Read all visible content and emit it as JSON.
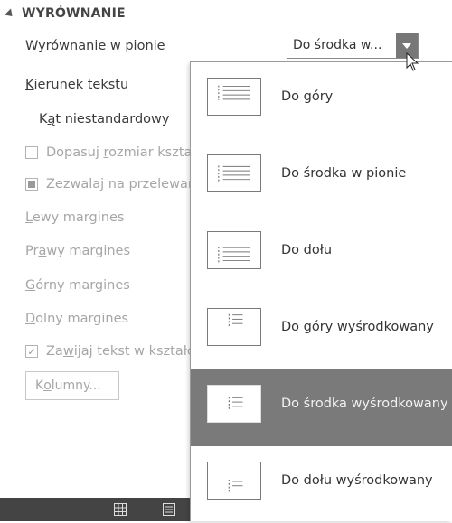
{
  "section": {
    "title": "WYRÓWNANIE"
  },
  "vertical_align": {
    "label_pre": "Wyrównan",
    "label_underlined": "i",
    "label_post": "e w pionie",
    "value": "Do środka w..."
  },
  "text_direction": {
    "label_underlined": "K",
    "label_post": "ierunek tekstu"
  },
  "custom_angle": {
    "label_pre": "K",
    "label_underlined": "ą",
    "label_post": "t niestandardowy"
  },
  "fit_shape": {
    "label_pre": "Dopasuj ",
    "label_underlined": "r",
    "label_post": "ozmiar kszta"
  },
  "allow_overflow": {
    "label": "Zezwalaj na przelewan"
  },
  "left_margin": {
    "label_underlined": "L",
    "label_post": "ewy margines"
  },
  "right_margin": {
    "label_pre": "Pr",
    "label_underlined": "a",
    "label_post": "wy margines"
  },
  "top_margin": {
    "label_underlined": "G",
    "label_post": "órny margines"
  },
  "bottom_margin": {
    "label_underlined": "D",
    "label_post": "olny margines"
  },
  "wrap_text": {
    "label_pre": "Za",
    "label_underlined": "w",
    "label_post": "ijaj tekst w kształc"
  },
  "columns": {
    "label_pre": "K",
    "label_underlined": "o",
    "label_post": "lumny..."
  },
  "dropdown": {
    "options": [
      {
        "label": "Do góry",
        "icon": "align-top-icon",
        "selected": false
      },
      {
        "label": "Do środka w pionie",
        "icon": "align-middle-icon",
        "selected": false
      },
      {
        "label": "Do dołu",
        "icon": "align-bottom-icon",
        "selected": false
      },
      {
        "label": "Do góry wyśrodkowany",
        "icon": "align-top-centered-icon",
        "selected": false
      },
      {
        "label": "Do środka wyśrodkowany",
        "icon": "align-middle-centered-icon",
        "selected": true
      },
      {
        "label": "Do dołu wyśrodkowany",
        "icon": "align-bottom-centered-icon",
        "selected": false
      }
    ]
  },
  "colors": {
    "selected_bg": "#7a7a7a",
    "disabled_text": "#a6a6a6",
    "bottom_bar": "#444444"
  }
}
